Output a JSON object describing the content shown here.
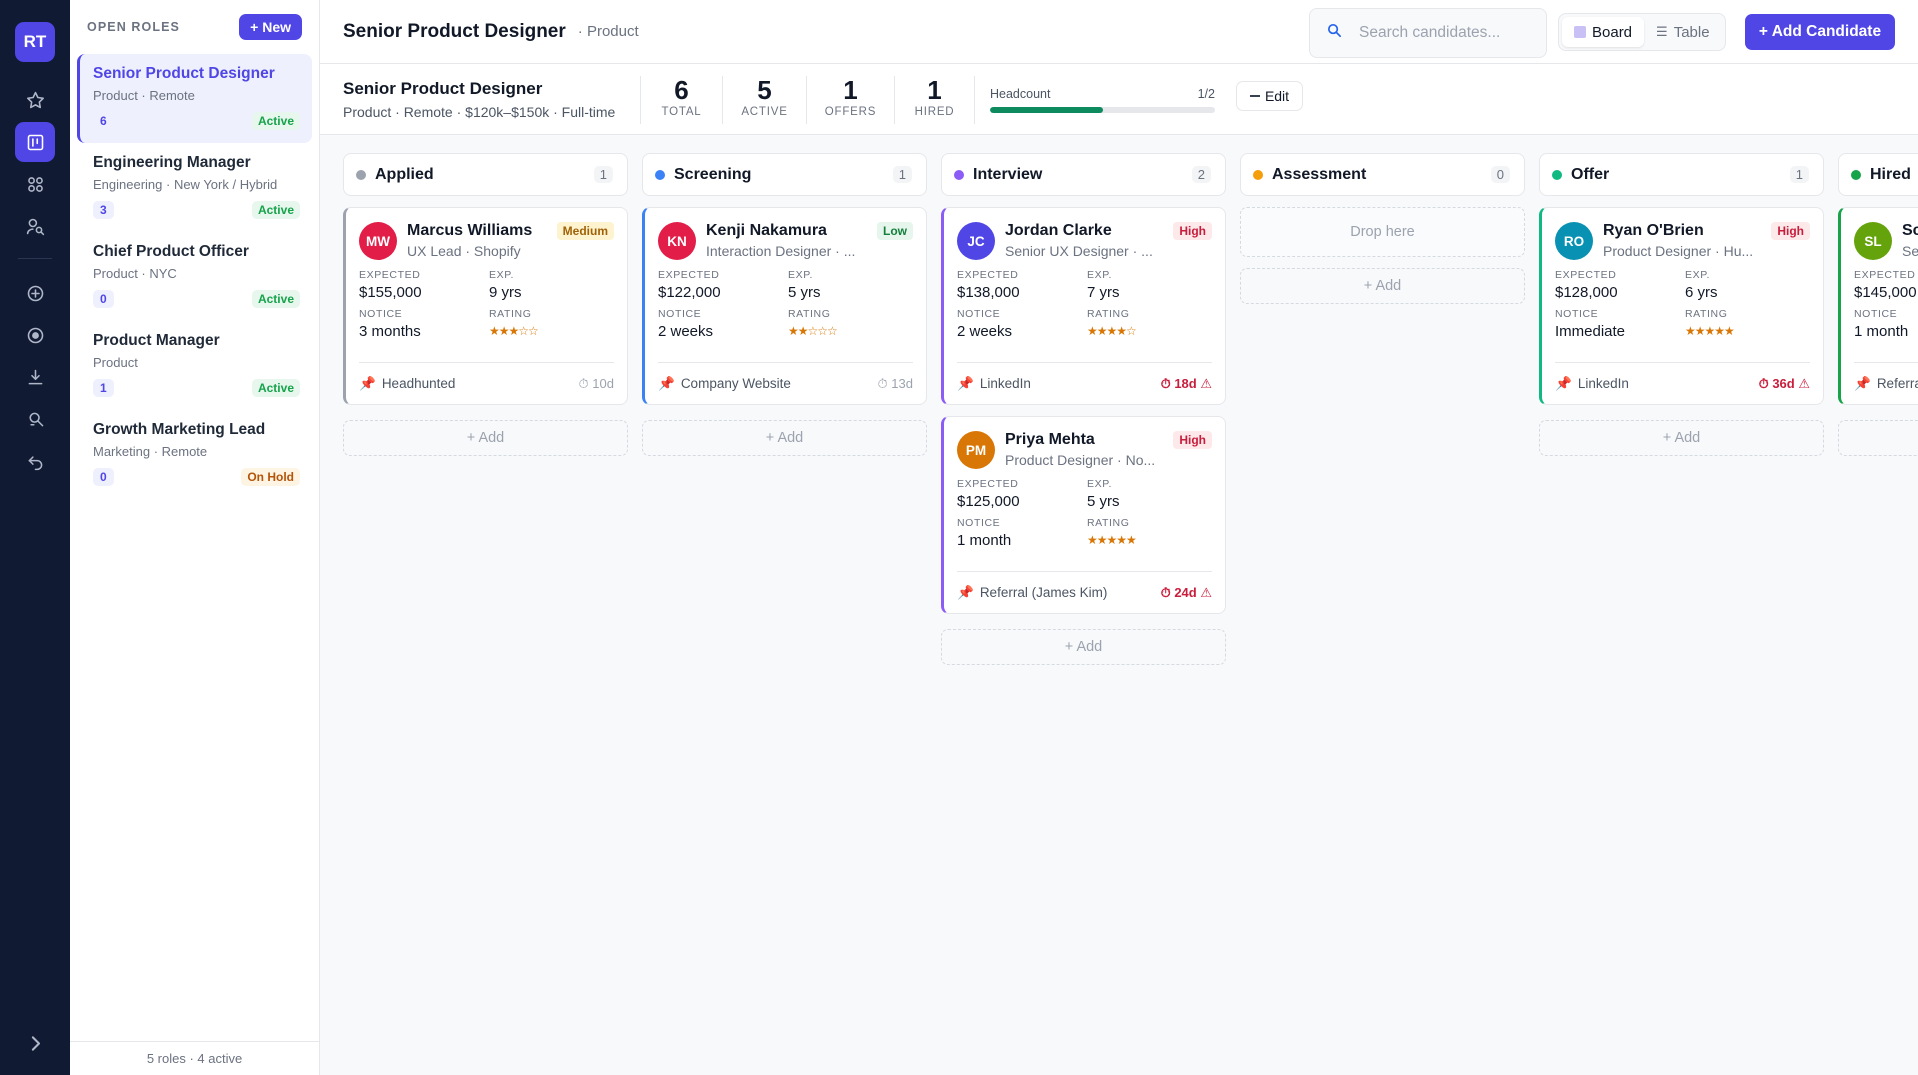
{
  "rail": {
    "logo": "RT",
    "items": [
      "star-icon",
      "board-icon",
      "grid-icon",
      "user-search-icon",
      "plus-circle-icon",
      "target-icon",
      "download-icon",
      "search-user-icon",
      "undo-icon"
    ]
  },
  "roles_panel": {
    "title": "OPEN ROLES",
    "new_label": "+ New",
    "roles": [
      {
        "name": "Senior Product Designer",
        "meta": "Product · Remote",
        "count": "6",
        "status": "Active"
      },
      {
        "name": "Engineering Manager",
        "meta": "Engineering · New York / Hybrid",
        "count": "3",
        "status": "Active"
      },
      {
        "name": "Chief Product Officer",
        "meta": "Product · NYC",
        "count": "0",
        "status": "Active"
      },
      {
        "name": "Product Manager",
        "meta": "Product",
        "count": "1",
        "status": "Active"
      },
      {
        "name": "Growth Marketing Lead",
        "meta": "Marketing · Remote",
        "count": "0",
        "status": "On Hold"
      }
    ],
    "footer": "5 roles · 4 active"
  },
  "header": {
    "title": "Senior Product Designer",
    "dept": "· Product",
    "search_placeholder": "Search candidates...",
    "view_board": "Board",
    "view_table": "Table",
    "add_candidate": "+ Add Candidate"
  },
  "summary": {
    "title": "Senior Product Designer",
    "meta": "Product · Remote · $120k–$150k · Full-time",
    "stats": [
      {
        "value": "6",
        "label": "TOTAL"
      },
      {
        "value": "5",
        "label": "ACTIVE"
      },
      {
        "value": "1",
        "label": "OFFERS"
      },
      {
        "value": "1",
        "label": "HIRED"
      }
    ],
    "headcount_label": "Headcount",
    "headcount_value": "1/2",
    "headcount_fraction": 0.5,
    "edit_label": "Edit"
  },
  "labels": {
    "expected": "EXPECTED",
    "exp": "EXP.",
    "notice": "NOTICE",
    "rating": "RATING",
    "add": "+ Add",
    "drop": "Drop here"
  },
  "colors": {
    "accent": "#5046e5",
    "applied": "#9ca3af",
    "screening": "#3b82f6",
    "interview": "#8b5cf6",
    "assessment": "#f59e0b",
    "offer": "#10b981",
    "hired": "#16a34a"
  },
  "columns": [
    {
      "name": "Applied",
      "count": "1",
      "color": "#9ca3af",
      "cards": [
        {
          "initials": "MW",
          "avatar": "#e11d48",
          "name": "Marcus Williams",
          "role": "UX Lead · Shopify",
          "priority": "Medium",
          "expected": "$155,000",
          "exp": "9 yrs",
          "notice": "3 months",
          "rating": "★★★☆☆",
          "source": "Headhunted",
          "age": "⏱ 10d",
          "warn": false
        }
      ]
    },
    {
      "name": "Screening",
      "count": "1",
      "color": "#3b82f6",
      "cards": [
        {
          "initials": "KN",
          "avatar": "#e11d48",
          "name": "Kenji Nakamura",
          "role": "Interaction Designer · ...",
          "priority": "Low",
          "expected": "$122,000",
          "exp": "5 yrs",
          "notice": "2 weeks",
          "rating": "★★☆☆☆",
          "source": "Company Website",
          "age": "⏱ 13d",
          "warn": false
        }
      ]
    },
    {
      "name": "Interview",
      "count": "2",
      "color": "#8b5cf6",
      "cards": [
        {
          "initials": "JC",
          "avatar": "#5046e5",
          "name": "Jordan Clarke",
          "role": "Senior UX Designer · ...",
          "priority": "High",
          "expected": "$138,000",
          "exp": "7 yrs",
          "notice": "2 weeks",
          "rating": "★★★★☆",
          "source": "LinkedIn",
          "age": "⏱ 18d ⚠",
          "warn": true
        },
        {
          "initials": "PM",
          "avatar": "#d97706",
          "name": "Priya Mehta",
          "role": "Product Designer · No...",
          "priority": "High",
          "expected": "$125,000",
          "exp": "5 yrs",
          "notice": "1 month",
          "rating": "★★★★★",
          "source": "Referral (James Kim)",
          "age": "⏱ 24d ⚠",
          "warn": true
        }
      ]
    },
    {
      "name": "Assessment",
      "count": "0",
      "color": "#f59e0b",
      "cards": []
    },
    {
      "name": "Offer",
      "count": "1",
      "color": "#10b981",
      "cards": [
        {
          "initials": "RO",
          "avatar": "#0891b2",
          "name": "Ryan O'Brien",
          "role": "Product Designer · Hu...",
          "priority": "High",
          "expected": "$128,000",
          "exp": "6 yrs",
          "notice": "Immediate",
          "rating": "★★★★★",
          "source": "LinkedIn",
          "age": "⏱ 36d ⚠",
          "warn": true
        }
      ]
    },
    {
      "name": "Hired",
      "count": "",
      "color": "#16a34a",
      "cards": [
        {
          "initials": "SL",
          "avatar": "#65a30d",
          "name": "Sc",
          "role": "Se",
          "priority": "",
          "expected": "$145,000",
          "exp": "",
          "notice": "1 month",
          "rating": "",
          "source": "Referra",
          "age": "",
          "warn": false
        }
      ]
    }
  ]
}
